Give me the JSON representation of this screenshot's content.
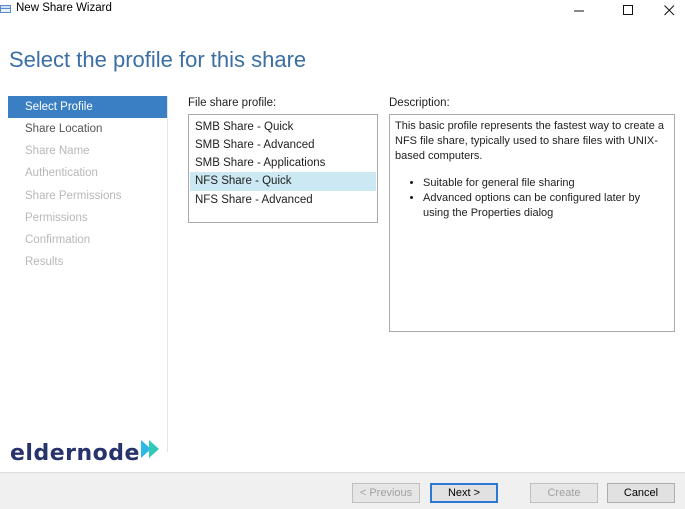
{
  "window": {
    "title": "New Share Wizard"
  },
  "page_title": "Select the profile for this share",
  "nav": [
    {
      "label": "Select Profile",
      "state": "active"
    },
    {
      "label": "Share Location",
      "state": "enabled"
    },
    {
      "label": "Share Name",
      "state": "disabled"
    },
    {
      "label": "Authentication",
      "state": "disabled"
    },
    {
      "label": "Share Permissions",
      "state": "disabled"
    },
    {
      "label": "Permissions",
      "state": "disabled"
    },
    {
      "label": "Confirmation",
      "state": "disabled"
    },
    {
      "label": "Results",
      "state": "disabled"
    }
  ],
  "profiles": {
    "label": "File share profile:",
    "items": [
      {
        "label": "SMB Share - Quick"
      },
      {
        "label": "SMB Share - Advanced"
      },
      {
        "label": "SMB Share - Applications"
      },
      {
        "label": "NFS Share - Quick",
        "selected": true
      },
      {
        "label": "NFS Share - Advanced"
      }
    ]
  },
  "description": {
    "label": "Description:",
    "text": "This basic profile represents the fastest way to create a NFS file share, typically used to share files with UNIX-based computers.",
    "bullets": [
      "Suitable for general file sharing",
      "Advanced options can be configured later by using the Properties dialog"
    ]
  },
  "logo": {
    "text": "eldernode"
  },
  "buttons": {
    "previous": "< Previous",
    "next": "Next >",
    "create": "Create",
    "cancel": "Cancel"
  },
  "colors": {
    "accent": "#3a7fc4",
    "title": "#3a6ea5",
    "selection": "#cce8f3"
  }
}
